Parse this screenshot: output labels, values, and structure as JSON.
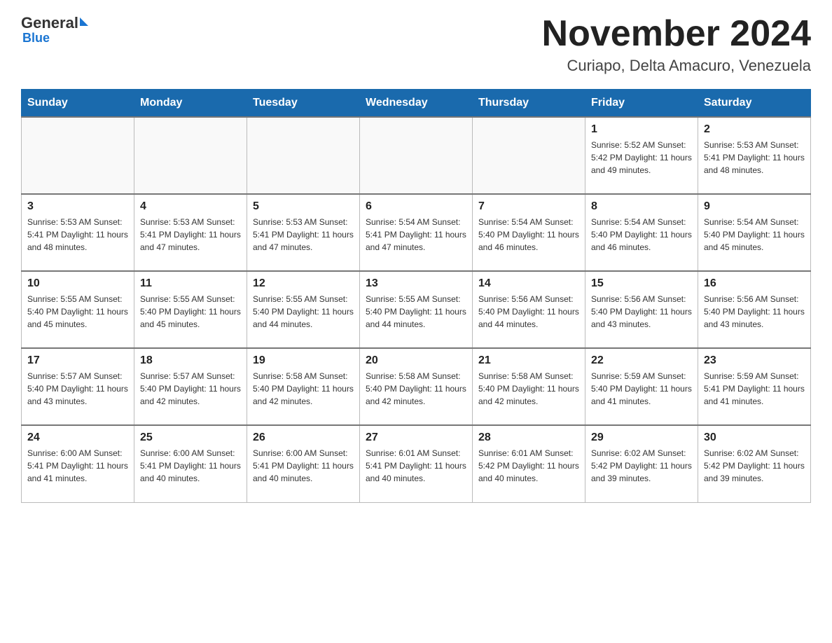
{
  "logo": {
    "general": "General",
    "blue": "Blue"
  },
  "header": {
    "title": "November 2024",
    "location": "Curiapo, Delta Amacuro, Venezuela"
  },
  "days_of_week": [
    "Sunday",
    "Monday",
    "Tuesday",
    "Wednesday",
    "Thursday",
    "Friday",
    "Saturday"
  ],
  "weeks": [
    [
      {
        "day": "",
        "info": ""
      },
      {
        "day": "",
        "info": ""
      },
      {
        "day": "",
        "info": ""
      },
      {
        "day": "",
        "info": ""
      },
      {
        "day": "",
        "info": ""
      },
      {
        "day": "1",
        "info": "Sunrise: 5:52 AM\nSunset: 5:42 PM\nDaylight: 11 hours and 49 minutes."
      },
      {
        "day": "2",
        "info": "Sunrise: 5:53 AM\nSunset: 5:41 PM\nDaylight: 11 hours and 48 minutes."
      }
    ],
    [
      {
        "day": "3",
        "info": "Sunrise: 5:53 AM\nSunset: 5:41 PM\nDaylight: 11 hours and 48 minutes."
      },
      {
        "day": "4",
        "info": "Sunrise: 5:53 AM\nSunset: 5:41 PM\nDaylight: 11 hours and 47 minutes."
      },
      {
        "day": "5",
        "info": "Sunrise: 5:53 AM\nSunset: 5:41 PM\nDaylight: 11 hours and 47 minutes."
      },
      {
        "day": "6",
        "info": "Sunrise: 5:54 AM\nSunset: 5:41 PM\nDaylight: 11 hours and 47 minutes."
      },
      {
        "day": "7",
        "info": "Sunrise: 5:54 AM\nSunset: 5:40 PM\nDaylight: 11 hours and 46 minutes."
      },
      {
        "day": "8",
        "info": "Sunrise: 5:54 AM\nSunset: 5:40 PM\nDaylight: 11 hours and 46 minutes."
      },
      {
        "day": "9",
        "info": "Sunrise: 5:54 AM\nSunset: 5:40 PM\nDaylight: 11 hours and 45 minutes."
      }
    ],
    [
      {
        "day": "10",
        "info": "Sunrise: 5:55 AM\nSunset: 5:40 PM\nDaylight: 11 hours and 45 minutes."
      },
      {
        "day": "11",
        "info": "Sunrise: 5:55 AM\nSunset: 5:40 PM\nDaylight: 11 hours and 45 minutes."
      },
      {
        "day": "12",
        "info": "Sunrise: 5:55 AM\nSunset: 5:40 PM\nDaylight: 11 hours and 44 minutes."
      },
      {
        "day": "13",
        "info": "Sunrise: 5:55 AM\nSunset: 5:40 PM\nDaylight: 11 hours and 44 minutes."
      },
      {
        "day": "14",
        "info": "Sunrise: 5:56 AM\nSunset: 5:40 PM\nDaylight: 11 hours and 44 minutes."
      },
      {
        "day": "15",
        "info": "Sunrise: 5:56 AM\nSunset: 5:40 PM\nDaylight: 11 hours and 43 minutes."
      },
      {
        "day": "16",
        "info": "Sunrise: 5:56 AM\nSunset: 5:40 PM\nDaylight: 11 hours and 43 minutes."
      }
    ],
    [
      {
        "day": "17",
        "info": "Sunrise: 5:57 AM\nSunset: 5:40 PM\nDaylight: 11 hours and 43 minutes."
      },
      {
        "day": "18",
        "info": "Sunrise: 5:57 AM\nSunset: 5:40 PM\nDaylight: 11 hours and 42 minutes."
      },
      {
        "day": "19",
        "info": "Sunrise: 5:58 AM\nSunset: 5:40 PM\nDaylight: 11 hours and 42 minutes."
      },
      {
        "day": "20",
        "info": "Sunrise: 5:58 AM\nSunset: 5:40 PM\nDaylight: 11 hours and 42 minutes."
      },
      {
        "day": "21",
        "info": "Sunrise: 5:58 AM\nSunset: 5:40 PM\nDaylight: 11 hours and 42 minutes."
      },
      {
        "day": "22",
        "info": "Sunrise: 5:59 AM\nSunset: 5:40 PM\nDaylight: 11 hours and 41 minutes."
      },
      {
        "day": "23",
        "info": "Sunrise: 5:59 AM\nSunset: 5:41 PM\nDaylight: 11 hours and 41 minutes."
      }
    ],
    [
      {
        "day": "24",
        "info": "Sunrise: 6:00 AM\nSunset: 5:41 PM\nDaylight: 11 hours and 41 minutes."
      },
      {
        "day": "25",
        "info": "Sunrise: 6:00 AM\nSunset: 5:41 PM\nDaylight: 11 hours and 40 minutes."
      },
      {
        "day": "26",
        "info": "Sunrise: 6:00 AM\nSunset: 5:41 PM\nDaylight: 11 hours and 40 minutes."
      },
      {
        "day": "27",
        "info": "Sunrise: 6:01 AM\nSunset: 5:41 PM\nDaylight: 11 hours and 40 minutes."
      },
      {
        "day": "28",
        "info": "Sunrise: 6:01 AM\nSunset: 5:42 PM\nDaylight: 11 hours and 40 minutes."
      },
      {
        "day": "29",
        "info": "Sunrise: 6:02 AM\nSunset: 5:42 PM\nDaylight: 11 hours and 39 minutes."
      },
      {
        "day": "30",
        "info": "Sunrise: 6:02 AM\nSunset: 5:42 PM\nDaylight: 11 hours and 39 minutes."
      }
    ]
  ]
}
